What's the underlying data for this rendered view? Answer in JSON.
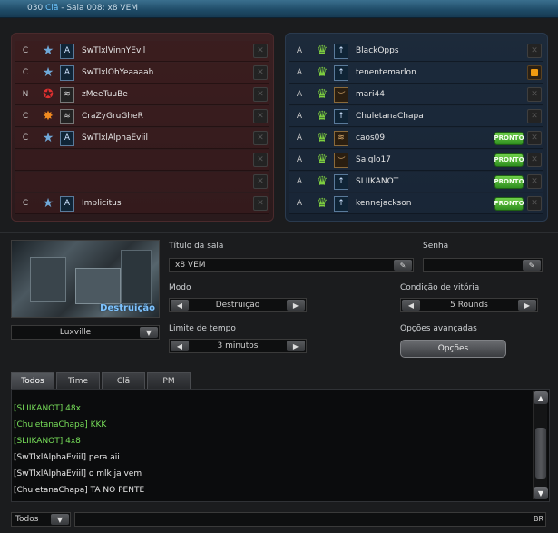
{
  "window": {
    "title_prefix": "030 ",
    "title_accent": "Clã",
    "title_rest": " - Sala 008: x8 VEM"
  },
  "red_team": [
    {
      "clan": "C",
      "rank_icon": "star-rank-icon",
      "insignia": "A",
      "name": "SwTlxlVinnYEvil",
      "insignia_style": "blue"
    },
    {
      "clan": "C",
      "rank_icon": "star-rank-icon",
      "insignia": "A",
      "name": "SwTlxlOhYeaaaah",
      "insignia_style": "blue"
    },
    {
      "clan": "N",
      "rank_icon": "red-emblem-icon",
      "insignia": "≋",
      "name": "zMeeTuuBe",
      "insignia_style": "gray"
    },
    {
      "clan": "C",
      "rank_icon": "orange-emblem-icon",
      "insignia": "≋",
      "name": "CraZyGruGheR",
      "insignia_style": "gray"
    },
    {
      "clan": "C",
      "rank_icon": "star-rank-icon",
      "insignia": "A",
      "name": "SwTlxlAlphaEviil",
      "insignia_style": "blue"
    },
    {
      "clan": "",
      "rank_icon": "",
      "insignia": "",
      "name": "",
      "insignia_style": "blue",
      "empty": true
    },
    {
      "clan": "",
      "rank_icon": "",
      "insignia": "",
      "name": "",
      "insignia_style": "blue",
      "empty": true
    },
    {
      "clan": "C",
      "rank_icon": "star-rank-icon",
      "insignia": "A",
      "name": "Implicitus",
      "insignia_style": "blue"
    }
  ],
  "blue_team": [
    {
      "clan": "A",
      "rank_icon": "green-crown-icon",
      "insignia": "↑",
      "name": "BlackOpps",
      "insignia_style": "blue",
      "ready": false,
      "host": false
    },
    {
      "clan": "A",
      "rank_icon": "green-crown-icon",
      "insignia": "↑",
      "name": "tenentemarlon",
      "insignia_style": "blue",
      "ready": false,
      "host": true
    },
    {
      "clan": "A",
      "rank_icon": "green-crown-icon",
      "insignia": "︶",
      "name": "mari44",
      "insignia_style": "brown",
      "ready": false,
      "host": false
    },
    {
      "clan": "A",
      "rank_icon": "green-crown-icon",
      "insignia": "↑",
      "name": "ChuletanaChapa",
      "insignia_style": "blue",
      "ready": false,
      "host": false
    },
    {
      "clan": "A",
      "rank_icon": "green-crown-icon",
      "insignia": "≋",
      "name": "caos09",
      "insignia_style": "brown",
      "ready": true,
      "host": false
    },
    {
      "clan": "A",
      "rank_icon": "green-crown-icon",
      "insignia": "︶",
      "name": "Saiglo17",
      "insignia_style": "brown",
      "ready": true,
      "host": false
    },
    {
      "clan": "A",
      "rank_icon": "green-crown-icon",
      "insignia": "↑",
      "name": "SLIIKANOT",
      "insignia_style": "blue",
      "ready": true,
      "host": false
    },
    {
      "clan": "A",
      "rank_icon": "green-crown-icon",
      "insignia": "↑",
      "name": "kennejackson",
      "insignia_style": "blue",
      "ready": true,
      "host": false
    }
  ],
  "ready_label": "PRONTO",
  "map": {
    "mode_overlay": "Destruição",
    "name": "Luxville"
  },
  "room": {
    "title_label": "Título da sala",
    "title_value": "x8 VEM",
    "password_label": "Senha",
    "password_value": "",
    "mode_label": "Modo",
    "mode_value": "Destruição",
    "victory_label": "Condição de vitória",
    "victory_value": "5 Rounds",
    "time_label": "Limite de tempo",
    "time_value": "3 minutos",
    "advanced_label": "Opções avançadas",
    "options_button": "Opções"
  },
  "chat": {
    "tabs": [
      "Todos",
      "Time",
      "Clã",
      "PM"
    ],
    "active_tab": "Todos",
    "lines": [
      {
        "text": "[SLIIKANOT] 48x",
        "color": "green"
      },
      {
        "text": "[ChuletanaChapa] KKK",
        "color": "green"
      },
      {
        "text": "[SLIIKANOT] 4x8",
        "color": "green"
      },
      {
        "text": "[SwTlxlAlphaEviil] pera aii",
        "color": "white"
      },
      {
        "text": "[SwTlxlAlphaEviil] o mlk ja vem",
        "color": "white"
      },
      {
        "text": "[ChuletanaChapa] TA NO PENTE",
        "color": "white"
      }
    ],
    "channel": "Todos",
    "input_value": "",
    "lang": "BR"
  },
  "colors": {
    "green_text": "#78e05a",
    "ready_green": "#4fbf30",
    "title_accent": "#6ec6ff"
  }
}
